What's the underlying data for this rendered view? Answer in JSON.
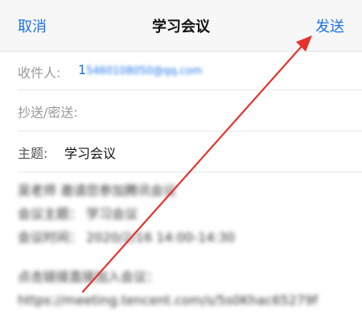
{
  "nav": {
    "cancel_label": "取消",
    "title": "学习会议",
    "send_label": "发送"
  },
  "fields": {
    "to_label": "收件人:",
    "to_first_char": "1",
    "to_value_blurred": "5460108050@qq.com",
    "cc_label": "抄送/密送:",
    "subject_label": "主题:",
    "subject_value": "学习会议"
  },
  "body": {
    "lines": [
      "吴老师 邀请您参加腾讯会议",
      "会议主题： 学习会议",
      "会议时间： 2020/2/16 14:00-14:30",
      "点击链接直接加入会议：",
      "https://meeting.tencent.com/s/5s0Khac65279f"
    ]
  },
  "annotation": {
    "arrow_color": "#e5322d"
  }
}
